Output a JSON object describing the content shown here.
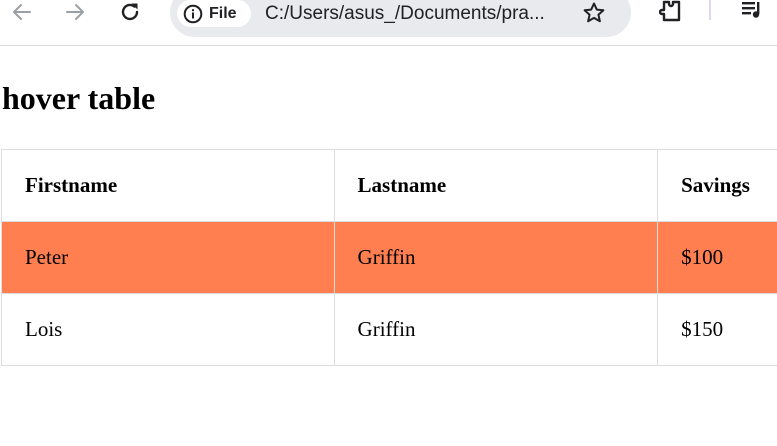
{
  "browser": {
    "chip_label": "File",
    "url": "C:/Users/asus_/Documents/pra...",
    "icons": {
      "back": "arrow-left-icon",
      "forward": "arrow-right-icon",
      "reload": "reload-icon",
      "info": "info-icon",
      "bookmark": "star-icon",
      "extensions": "puzzle-icon",
      "media": "media-control-icon"
    }
  },
  "page": {
    "title": "hover table"
  },
  "table": {
    "headers": [
      "Firstname",
      "Lastname",
      "Savings"
    ],
    "rows": [
      [
        "Peter",
        "Griffin",
        "$100"
      ],
      [
        "Lois",
        "Griffin",
        "$150"
      ]
    ],
    "hovered_row_index": 0
  },
  "colors": {
    "hover_row": "#ff7f50",
    "border": "#dddddd",
    "omnibox": "#e8eaed"
  }
}
